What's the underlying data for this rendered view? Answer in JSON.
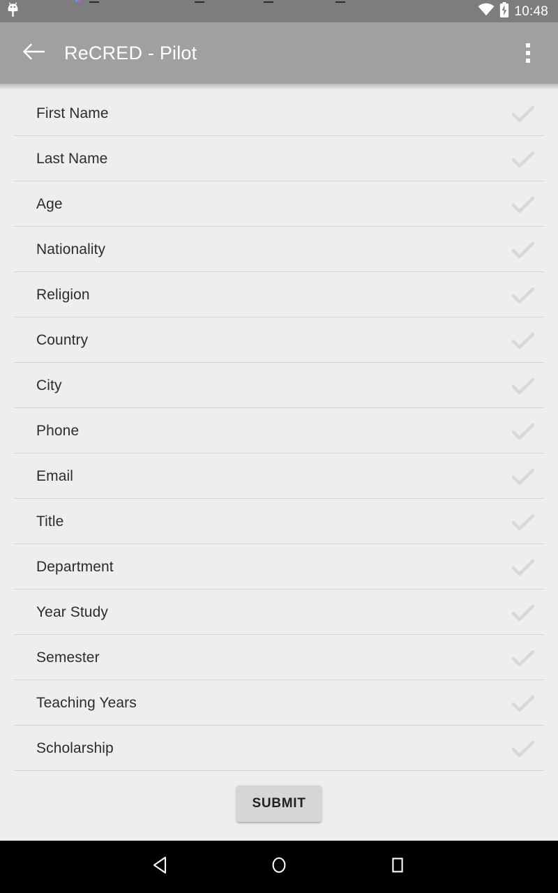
{
  "status_bar": {
    "notification_icon": "android-robot-icon",
    "wifi_icon": "wifi-icon",
    "battery_icon": "battery-charging-icon",
    "time": "10:48",
    "background_color": "#7d7d7d"
  },
  "app_bar": {
    "back_icon": "arrow-left-icon",
    "title": "ReCRED - Pilot",
    "overflow_icon": "more-vertical-icon",
    "background_color": "#a0a0a0",
    "text_color": "#ffffff"
  },
  "fields": [
    {
      "label": "First Name",
      "status_icon": "check-icon"
    },
    {
      "label": "Last Name",
      "status_icon": "check-icon"
    },
    {
      "label": "Age",
      "status_icon": "check-icon"
    },
    {
      "label": "Nationality",
      "status_icon": "check-icon"
    },
    {
      "label": "Religion",
      "status_icon": "check-icon"
    },
    {
      "label": "Country",
      "status_icon": "check-icon"
    },
    {
      "label": "City",
      "status_icon": "check-icon"
    },
    {
      "label": "Phone",
      "status_icon": "check-icon"
    },
    {
      "label": "Email",
      "status_icon": "check-icon"
    },
    {
      "label": "Title",
      "status_icon": "check-icon"
    },
    {
      "label": "Department",
      "status_icon": "check-icon"
    },
    {
      "label": "Year Study",
      "status_icon": "check-icon"
    },
    {
      "label": "Semester",
      "status_icon": "check-icon"
    },
    {
      "label": "Teaching Years",
      "status_icon": "check-icon"
    },
    {
      "label": "Scholarship",
      "status_icon": "check-icon"
    }
  ],
  "submit": {
    "label": "SUBMIT",
    "background_color": "#d6d6d6",
    "text_color": "#212121"
  },
  "nav_bar": {
    "back_icon": "nav-back-triangle-icon",
    "home_icon": "nav-home-circle-icon",
    "recents_icon": "nav-recents-square-icon",
    "background_color": "#000000"
  },
  "theme": {
    "page_background": "#eeeeee",
    "divider_color": "#d3d3d3",
    "label_color": "#2c2c2c",
    "check_color": "#d8d8d8"
  }
}
